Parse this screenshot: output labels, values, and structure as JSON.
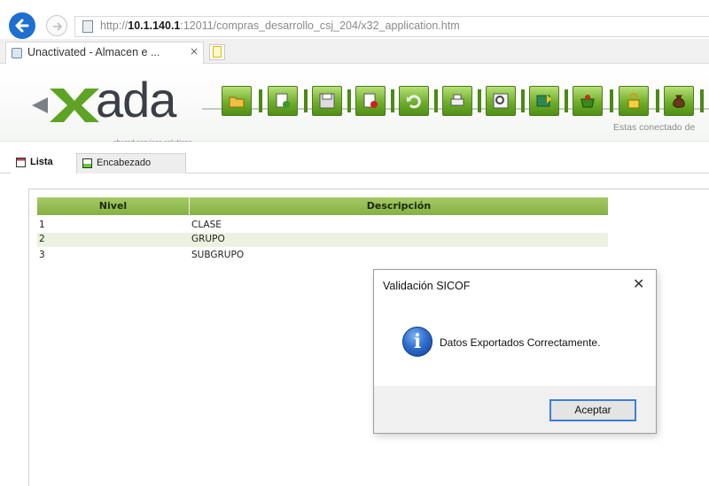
{
  "browser": {
    "url_prefix": "http://",
    "url_host": "10.1.140.1",
    "url_rest": ":12011/compras_desarrollo_csj_204/x32_application.htm",
    "tab_title": "Unactivated - Almacen e ...",
    "tab_close": "×"
  },
  "header": {
    "logo_word": "ada",
    "logo_tagline": "shared services solutions",
    "status_text": "Estas conectado de",
    "toolbar": [
      {
        "icon": "folder-icon"
      },
      {
        "icon": "add-page-icon"
      },
      {
        "icon": "save-icon"
      },
      {
        "icon": "delete-icon"
      },
      {
        "icon": "undo-icon"
      },
      {
        "icon": "print-icon"
      },
      {
        "icon": "search-icon"
      },
      {
        "icon": "export-icon"
      },
      {
        "icon": "basket-icon"
      },
      {
        "icon": "lock-icon"
      },
      {
        "icon": "money-bag-icon"
      }
    ]
  },
  "tabs": {
    "lista": "Lista",
    "encabezado": "Encabezado"
  },
  "grid": {
    "headers": {
      "nivel": "Nivel",
      "descripcion": "Descripción"
    },
    "rows": [
      {
        "nivel": "1",
        "descripcion": "CLASE"
      },
      {
        "nivel": "2",
        "descripcion": "GRUPO"
      },
      {
        "nivel": "3",
        "descripcion": "SUBGRUPO"
      }
    ]
  },
  "dialog": {
    "title": "Validación SICOF",
    "close": "✕",
    "info_glyph": "i",
    "message": "Datos Exportados Correctamente.",
    "ok_label": "Aceptar"
  },
  "colors": {
    "accent_green": "#6fae2a",
    "grid_header": "#a5c964",
    "row_alt": "#eaf3e0",
    "browser_blue": "#1e6fd0",
    "focus_blue": "#3c7fd6"
  }
}
